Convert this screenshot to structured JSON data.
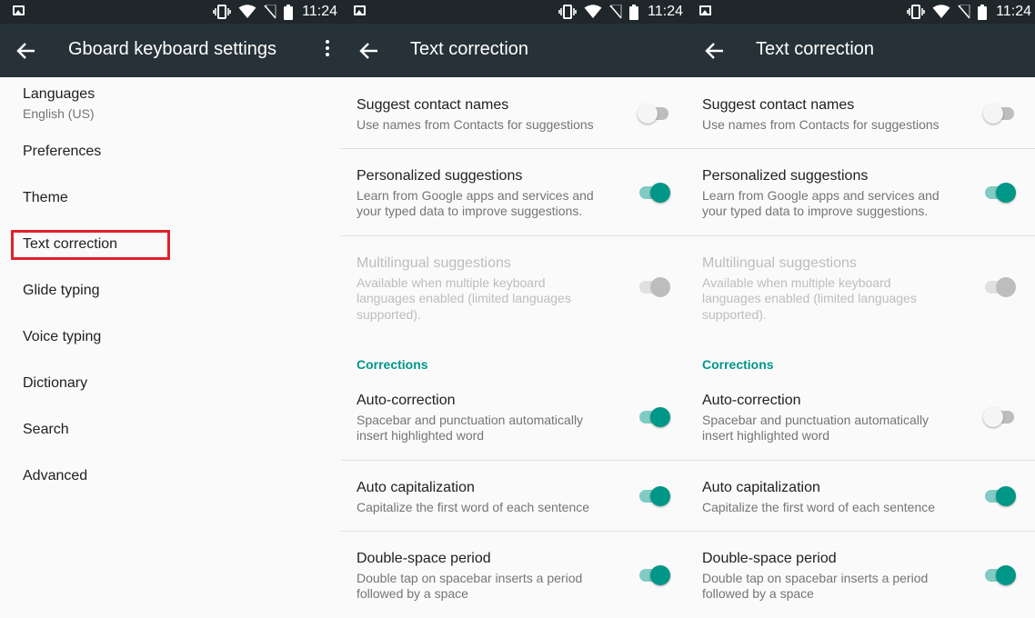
{
  "status_bar": {
    "time": "11:24",
    "icons": [
      "image-icon",
      "vibrate-icon",
      "wifi-icon",
      "no-sim-icon",
      "battery-icon"
    ]
  },
  "colors": {
    "app_bar": "#263238",
    "status_bar": "#1f272b",
    "accent": "#009688",
    "highlight_box": "#e0212c"
  },
  "panel1": {
    "title": "Gboard keyboard settings",
    "menu": [
      {
        "label": "Languages",
        "sub": "English (US)"
      },
      {
        "label": "Preferences"
      },
      {
        "label": "Theme"
      },
      {
        "label": "Text correction",
        "highlighted": true
      },
      {
        "label": "Glide typing"
      },
      {
        "label": "Voice typing"
      },
      {
        "label": "Dictionary"
      },
      {
        "label": "Search"
      },
      {
        "label": "Advanced"
      }
    ]
  },
  "panel2": {
    "title": "Text correction",
    "rows": [
      {
        "title": "Suggest contact names",
        "summary": [
          "Use names from Contacts for suggestions"
        ],
        "toggle": "off"
      },
      {
        "title": "Personalized suggestions",
        "summary": [
          "Learn from Google apps and services and",
          "your typed data to improve suggestions."
        ],
        "toggle": "on"
      },
      {
        "title": "Multilingual suggestions",
        "summary": [
          "Available when multiple keyboard",
          "languages enabled (limited languages",
          "supported)."
        ],
        "toggle": "disabled"
      },
      {
        "title": "Auto-correction",
        "summary": [
          "Spacebar and punctuation automatically",
          "insert highlighted word"
        ],
        "toggle": "on"
      },
      {
        "title": "Auto capitalization",
        "summary": [
          "Capitalize the first word of each sentence"
        ],
        "toggle": "on"
      },
      {
        "title": "Double-space period",
        "summary": [
          "Double tap on spacebar inserts a period",
          "followed by a space"
        ],
        "toggle": "on"
      }
    ],
    "section_label": "Corrections"
  },
  "panel3": {
    "title": "Text correction",
    "rows": [
      {
        "title": "Suggest contact names",
        "summary": [
          "Use names from Contacts for suggestions"
        ],
        "toggle": "off"
      },
      {
        "title": "Personalized suggestions",
        "summary": [
          "Learn from Google apps and services and",
          "your typed data to improve suggestions."
        ],
        "toggle": "on"
      },
      {
        "title": "Multilingual suggestions",
        "summary": [
          "Available when multiple keyboard",
          "languages enabled (limited languages",
          "supported)."
        ],
        "toggle": "disabled"
      },
      {
        "title": "Auto-correction",
        "summary": [
          "Spacebar and punctuation automatically",
          "insert highlighted word"
        ],
        "toggle": "off"
      },
      {
        "title": "Auto capitalization",
        "summary": [
          "Capitalize the first word of each sentence"
        ],
        "toggle": "on"
      },
      {
        "title": "Double-space period",
        "summary": [
          "Double tap on spacebar inserts a period",
          "followed by a space"
        ],
        "toggle": "on"
      }
    ],
    "section_label": "Corrections"
  }
}
